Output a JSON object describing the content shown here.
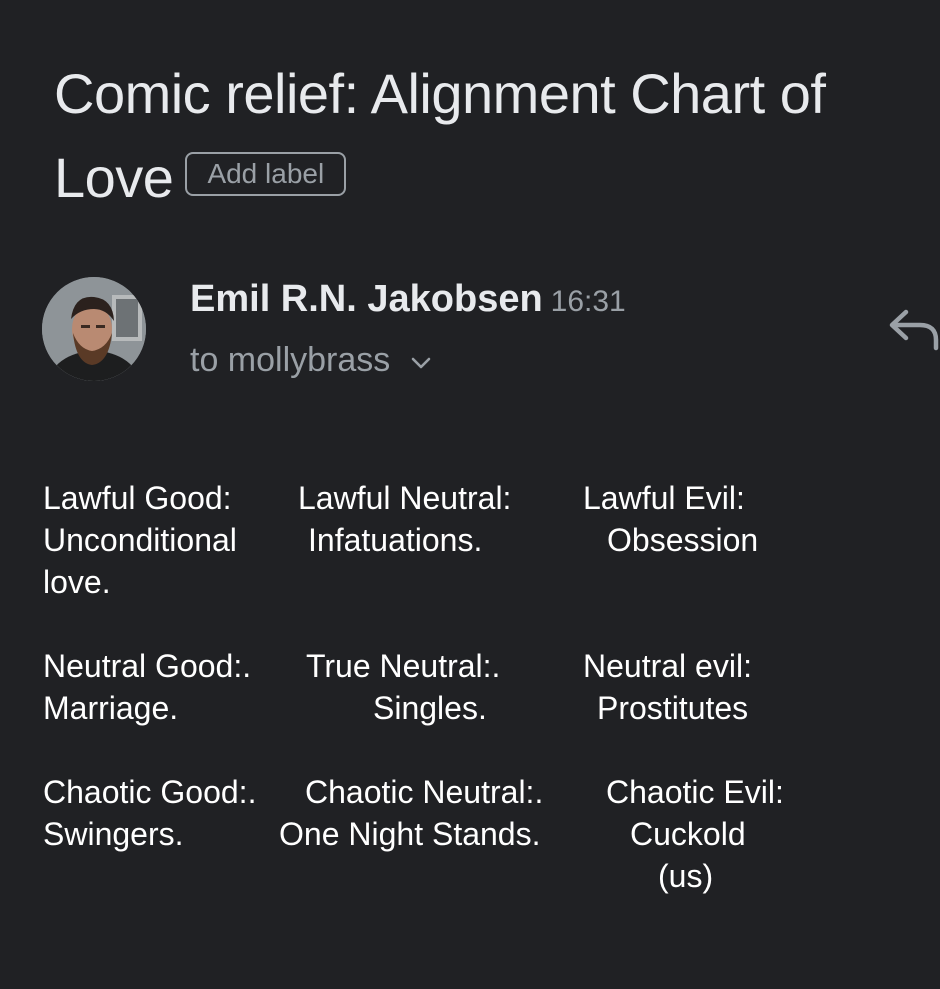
{
  "subject": "Comic relief: Alignment Chart of Love",
  "label_chip": "Add label",
  "sender": {
    "name": "Emil R.N. Jakobsen",
    "time": "16:31",
    "recipient": "to mollybrass"
  },
  "icons": {
    "recipient_toggle": "chevron-down-icon",
    "reply": "reply-icon",
    "avatar": "profile-photo"
  },
  "colors": {
    "background": "#202124",
    "primary_text": "#e8eaed",
    "secondary_text": "#9aa0a6",
    "body_text": "#ffffff"
  },
  "body": {
    "lawful_good": [
      "Lawful Good:",
      "Unconditional",
      "love."
    ],
    "lawful_neutral": [
      "Lawful Neutral:",
      "Infatuations."
    ],
    "lawful_evil": [
      "Lawful Evil:",
      "Obsession"
    ],
    "neutral_good": [
      "Neutral Good:.",
      "Marriage."
    ],
    "true_neutral": [
      "True Neutral:.",
      "Singles."
    ],
    "neutral_evil": [
      "Neutral evil:",
      "Prostitutes"
    ],
    "chaotic_good": [
      "Chaotic Good:.",
      "Swingers."
    ],
    "chaotic_neutral": [
      "Chaotic Neutral:.",
      "One Night Stands."
    ],
    "chaotic_evil": [
      "Chaotic Evil:",
      "Cuckold",
      "(us)"
    ]
  }
}
